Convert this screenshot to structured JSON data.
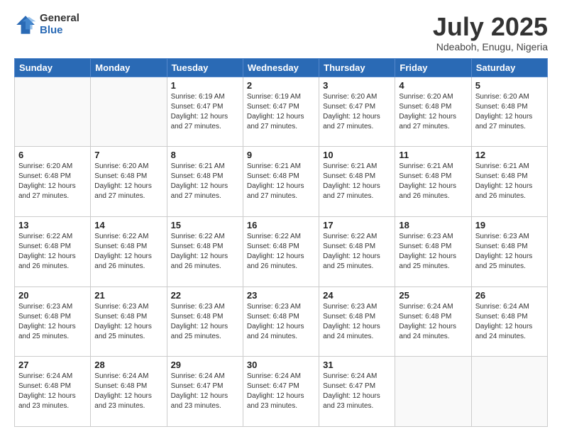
{
  "logo": {
    "general": "General",
    "blue": "Blue"
  },
  "header": {
    "month": "July 2025",
    "location": "Ndeaboh, Enugu, Nigeria"
  },
  "weekdays": [
    "Sunday",
    "Monday",
    "Tuesday",
    "Wednesday",
    "Thursday",
    "Friday",
    "Saturday"
  ],
  "weeks": [
    [
      {
        "day": "",
        "sunrise": "",
        "sunset": "",
        "daylight": ""
      },
      {
        "day": "",
        "sunrise": "",
        "sunset": "",
        "daylight": ""
      },
      {
        "day": "1",
        "sunrise": "Sunrise: 6:19 AM",
        "sunset": "Sunset: 6:47 PM",
        "daylight": "Daylight: 12 hours and 27 minutes."
      },
      {
        "day": "2",
        "sunrise": "Sunrise: 6:19 AM",
        "sunset": "Sunset: 6:47 PM",
        "daylight": "Daylight: 12 hours and 27 minutes."
      },
      {
        "day": "3",
        "sunrise": "Sunrise: 6:20 AM",
        "sunset": "Sunset: 6:47 PM",
        "daylight": "Daylight: 12 hours and 27 minutes."
      },
      {
        "day": "4",
        "sunrise": "Sunrise: 6:20 AM",
        "sunset": "Sunset: 6:48 PM",
        "daylight": "Daylight: 12 hours and 27 minutes."
      },
      {
        "day": "5",
        "sunrise": "Sunrise: 6:20 AM",
        "sunset": "Sunset: 6:48 PM",
        "daylight": "Daylight: 12 hours and 27 minutes."
      }
    ],
    [
      {
        "day": "6",
        "sunrise": "Sunrise: 6:20 AM",
        "sunset": "Sunset: 6:48 PM",
        "daylight": "Daylight: 12 hours and 27 minutes."
      },
      {
        "day": "7",
        "sunrise": "Sunrise: 6:20 AM",
        "sunset": "Sunset: 6:48 PM",
        "daylight": "Daylight: 12 hours and 27 minutes."
      },
      {
        "day": "8",
        "sunrise": "Sunrise: 6:21 AM",
        "sunset": "Sunset: 6:48 PM",
        "daylight": "Daylight: 12 hours and 27 minutes."
      },
      {
        "day": "9",
        "sunrise": "Sunrise: 6:21 AM",
        "sunset": "Sunset: 6:48 PM",
        "daylight": "Daylight: 12 hours and 27 minutes."
      },
      {
        "day": "10",
        "sunrise": "Sunrise: 6:21 AM",
        "sunset": "Sunset: 6:48 PM",
        "daylight": "Daylight: 12 hours and 27 minutes."
      },
      {
        "day": "11",
        "sunrise": "Sunrise: 6:21 AM",
        "sunset": "Sunset: 6:48 PM",
        "daylight": "Daylight: 12 hours and 26 minutes."
      },
      {
        "day": "12",
        "sunrise": "Sunrise: 6:21 AM",
        "sunset": "Sunset: 6:48 PM",
        "daylight": "Daylight: 12 hours and 26 minutes."
      }
    ],
    [
      {
        "day": "13",
        "sunrise": "Sunrise: 6:22 AM",
        "sunset": "Sunset: 6:48 PM",
        "daylight": "Daylight: 12 hours and 26 minutes."
      },
      {
        "day": "14",
        "sunrise": "Sunrise: 6:22 AM",
        "sunset": "Sunset: 6:48 PM",
        "daylight": "Daylight: 12 hours and 26 minutes."
      },
      {
        "day": "15",
        "sunrise": "Sunrise: 6:22 AM",
        "sunset": "Sunset: 6:48 PM",
        "daylight": "Daylight: 12 hours and 26 minutes."
      },
      {
        "day": "16",
        "sunrise": "Sunrise: 6:22 AM",
        "sunset": "Sunset: 6:48 PM",
        "daylight": "Daylight: 12 hours and 26 minutes."
      },
      {
        "day": "17",
        "sunrise": "Sunrise: 6:22 AM",
        "sunset": "Sunset: 6:48 PM",
        "daylight": "Daylight: 12 hours and 25 minutes."
      },
      {
        "day": "18",
        "sunrise": "Sunrise: 6:23 AM",
        "sunset": "Sunset: 6:48 PM",
        "daylight": "Daylight: 12 hours and 25 minutes."
      },
      {
        "day": "19",
        "sunrise": "Sunrise: 6:23 AM",
        "sunset": "Sunset: 6:48 PM",
        "daylight": "Daylight: 12 hours and 25 minutes."
      }
    ],
    [
      {
        "day": "20",
        "sunrise": "Sunrise: 6:23 AM",
        "sunset": "Sunset: 6:48 PM",
        "daylight": "Daylight: 12 hours and 25 minutes."
      },
      {
        "day": "21",
        "sunrise": "Sunrise: 6:23 AM",
        "sunset": "Sunset: 6:48 PM",
        "daylight": "Daylight: 12 hours and 25 minutes."
      },
      {
        "day": "22",
        "sunrise": "Sunrise: 6:23 AM",
        "sunset": "Sunset: 6:48 PM",
        "daylight": "Daylight: 12 hours and 25 minutes."
      },
      {
        "day": "23",
        "sunrise": "Sunrise: 6:23 AM",
        "sunset": "Sunset: 6:48 PM",
        "daylight": "Daylight: 12 hours and 24 minutes."
      },
      {
        "day": "24",
        "sunrise": "Sunrise: 6:23 AM",
        "sunset": "Sunset: 6:48 PM",
        "daylight": "Daylight: 12 hours and 24 minutes."
      },
      {
        "day": "25",
        "sunrise": "Sunrise: 6:24 AM",
        "sunset": "Sunset: 6:48 PM",
        "daylight": "Daylight: 12 hours and 24 minutes."
      },
      {
        "day": "26",
        "sunrise": "Sunrise: 6:24 AM",
        "sunset": "Sunset: 6:48 PM",
        "daylight": "Daylight: 12 hours and 24 minutes."
      }
    ],
    [
      {
        "day": "27",
        "sunrise": "Sunrise: 6:24 AM",
        "sunset": "Sunset: 6:48 PM",
        "daylight": "Daylight: 12 hours and 23 minutes."
      },
      {
        "day": "28",
        "sunrise": "Sunrise: 6:24 AM",
        "sunset": "Sunset: 6:48 PM",
        "daylight": "Daylight: 12 hours and 23 minutes."
      },
      {
        "day": "29",
        "sunrise": "Sunrise: 6:24 AM",
        "sunset": "Sunset: 6:47 PM",
        "daylight": "Daylight: 12 hours and 23 minutes."
      },
      {
        "day": "30",
        "sunrise": "Sunrise: 6:24 AM",
        "sunset": "Sunset: 6:47 PM",
        "daylight": "Daylight: 12 hours and 23 minutes."
      },
      {
        "day": "31",
        "sunrise": "Sunrise: 6:24 AM",
        "sunset": "Sunset: 6:47 PM",
        "daylight": "Daylight: 12 hours and 23 minutes."
      },
      {
        "day": "",
        "sunrise": "",
        "sunset": "",
        "daylight": ""
      },
      {
        "day": "",
        "sunrise": "",
        "sunset": "",
        "daylight": ""
      }
    ]
  ]
}
